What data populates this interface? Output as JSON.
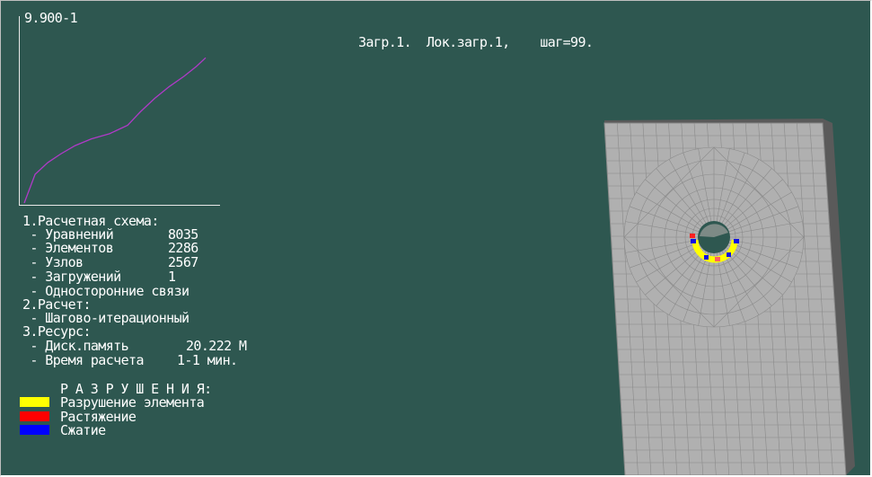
{
  "graph": {
    "ymax_label": "9.900-1",
    "curve_color": "#b03ac8",
    "curve": [
      [
        0,
        0
      ],
      [
        0.06,
        0.17
      ],
      [
        0.13,
        0.24
      ],
      [
        0.2,
        0.29
      ],
      [
        0.28,
        0.34
      ],
      [
        0.37,
        0.38
      ],
      [
        0.47,
        0.41
      ],
      [
        0.57,
        0.46
      ],
      [
        0.64,
        0.54
      ],
      [
        0.72,
        0.62
      ],
      [
        0.8,
        0.69
      ],
      [
        0.88,
        0.75
      ],
      [
        0.95,
        0.81
      ],
      [
        1.0,
        0.86
      ]
    ]
  },
  "header": {
    "title": "Загр.1.  Лок.загр.1,    шаг=99."
  },
  "info": {
    "section1_title": "1.Расчетная схема:",
    "equations_label": " - Уравнений",
    "equations_value": "8035",
    "elements_label": " - Элементов",
    "elements_value": "2286",
    "nodes_label": " - Узлов",
    "nodes_value": "2567",
    "loads_label": " - Загружений",
    "loads_value": "1",
    "oneway_label": " - Односторонние связи",
    "section2_title": "2.Расчет:",
    "method": " - Шагово-итерационный",
    "section3_title": "3.Ресурс:",
    "disk_label": " - Диск.память",
    "disk_value": "20.222 М",
    "time_label": " - Время расчета",
    "time_value": "1-1 мин."
  },
  "legend": {
    "title": "Р А З Р У Ш Е Н И Я:",
    "items": [
      {
        "label": "Разрушение элемента",
        "color": "#ffff00"
      },
      {
        "label": "Растяжение",
        "color": "#ff0000"
      },
      {
        "label": "Сжатие",
        "color": "#0000ff"
      }
    ]
  },
  "model": {
    "plate_color": "#b0b0b0",
    "mesh_color": "#8a8a8a",
    "side_color": "#5a5a5a",
    "hole_color": "#2e5750"
  }
}
